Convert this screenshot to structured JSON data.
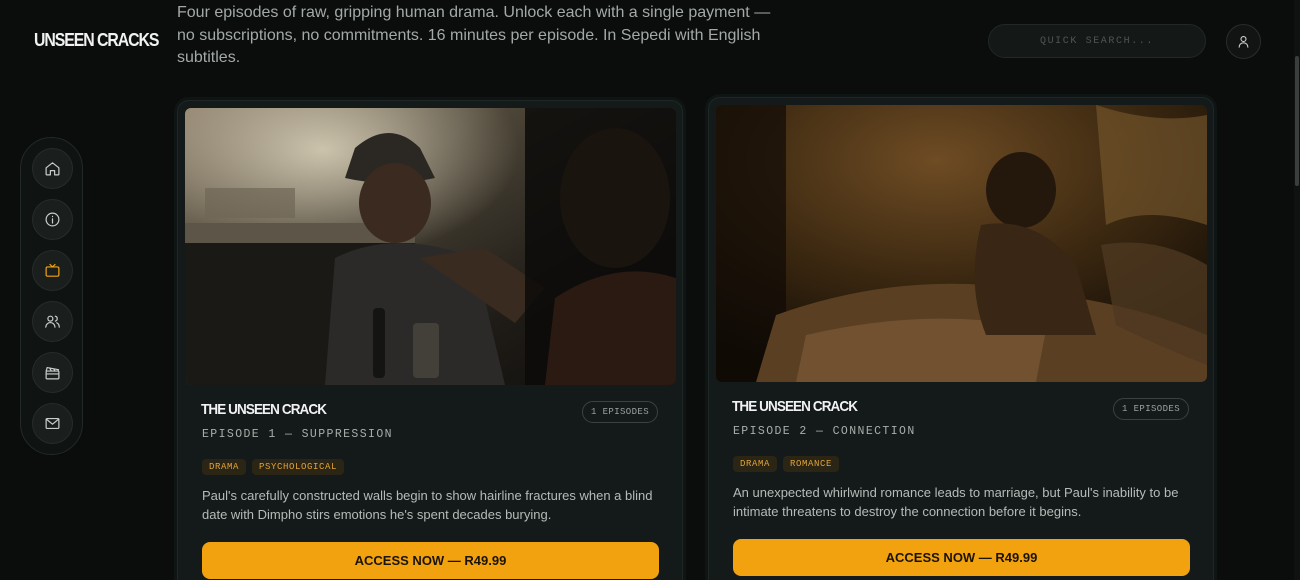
{
  "brand": {
    "logo_text": "UNSEEN CRACKS"
  },
  "intro": {
    "text": "Four episodes of raw, gripping human drama. Unlock each with a single payment — no subscriptions, no commitments. 16 minutes per episode. In Sepedi with English subtitles."
  },
  "search": {
    "placeholder": "QUICK SEARCH..."
  },
  "header": {
    "user_icon": "user-icon"
  },
  "sidebar": {
    "items": [
      {
        "icon": "home-icon"
      },
      {
        "icon": "info-icon"
      },
      {
        "icon": "tv-icon",
        "active": true
      },
      {
        "icon": "users-icon"
      },
      {
        "icon": "clapperboard-icon"
      },
      {
        "icon": "mail-icon"
      }
    ]
  },
  "colors": {
    "accent": "#f2a20e",
    "background": "#0b0d0c",
    "card": "#141a19",
    "tag_text": "#e0a33a"
  },
  "episodes": [
    {
      "title": "THE UNSEEN CRACK",
      "badge": "1 EPISODES",
      "subtitle": "EPISODE 1 — SUPPRESSION",
      "tags": [
        "DRAMA",
        "PSYCHOLOGICAL"
      ],
      "description": "Paul's carefully constructed walls begin to show hairline fractures when a blind date with Dimpho stirs emotions he's spent decades burying.",
      "cta": "ACCESS NOW — R49.99"
    },
    {
      "title": "THE UNSEEN CRACK",
      "badge": "1 EPISODES",
      "subtitle": "EPISODE 2 — CONNECTION",
      "tags": [
        "DRAMA",
        "ROMANCE"
      ],
      "description": "An unexpected whirlwind romance leads to marriage, but Paul's inability to be intimate threatens to destroy the connection before it begins.",
      "cta": "ACCESS NOW — R49.99"
    }
  ]
}
